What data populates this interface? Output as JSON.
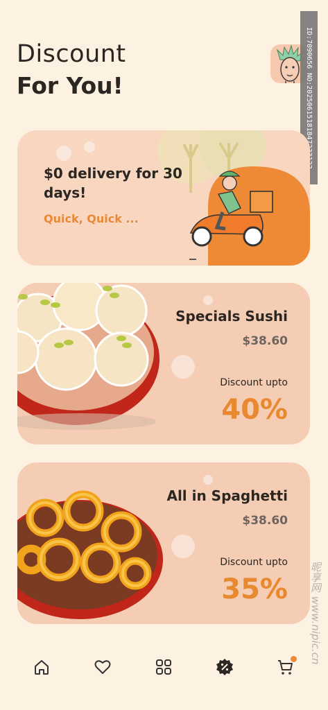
{
  "header": {
    "title_line1": "Discount",
    "title_line2": "For You!"
  },
  "watermark": {
    "id_text": "ID:7090656 NO:20250615181847233122",
    "side_text": "昵享网 www.nipic.cn"
  },
  "promo": {
    "title": "$0 delivery for 30 days!",
    "subtitle": "Quick, Quick ..."
  },
  "offers": [
    {
      "name": "Specials Sushi",
      "price": "$38.60",
      "discount_label": "Discount upto",
      "discount_value": "40%"
    },
    {
      "name": "All in Spaghetti",
      "price": "$38.60",
      "discount_label": "Discount upto",
      "discount_value": "35%"
    }
  ],
  "nav": {
    "items": [
      "home-icon",
      "heart-icon",
      "grid-icon",
      "discount-icon",
      "cart-icon"
    ],
    "active": "discount-icon"
  },
  "colors": {
    "background": "#fdf2e2",
    "accent": "#e8892f",
    "card": "#f4cdb4",
    "text": "#2b2622"
  }
}
